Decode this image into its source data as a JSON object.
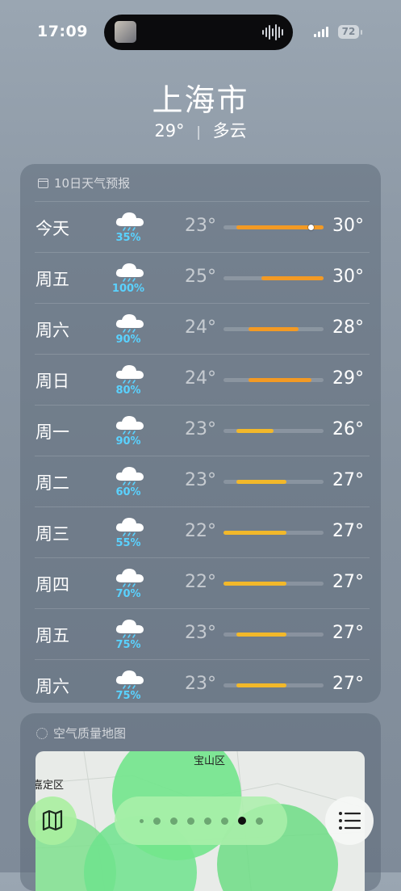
{
  "status_bar": {
    "time": "17:09",
    "battery": "72"
  },
  "location": {
    "city": "上海市",
    "temperature": "29°",
    "separator": "|",
    "condition": "多云"
  },
  "forecast": {
    "header": "10日天气预报",
    "scale_min": 22,
    "scale_max": 30,
    "current_temp": 29,
    "days": [
      {
        "day": "今天",
        "icon": "cloud-rain-icon",
        "precip": "35%",
        "low": "23°",
        "high": "30°",
        "lo": 23,
        "hi": 30
      },
      {
        "day": "周五",
        "icon": "cloud-rain-icon",
        "precip": "100%",
        "low": "25°",
        "high": "30°",
        "lo": 25,
        "hi": 30
      },
      {
        "day": "周六",
        "icon": "cloud-rain-icon",
        "precip": "90%",
        "low": "24°",
        "high": "28°",
        "lo": 24,
        "hi": 28
      },
      {
        "day": "周日",
        "icon": "cloud-rain-icon",
        "precip": "80%",
        "low": "24°",
        "high": "29°",
        "lo": 24,
        "hi": 29
      },
      {
        "day": "周一",
        "icon": "cloud-rain-icon",
        "precip": "90%",
        "low": "23°",
        "high": "26°",
        "lo": 23,
        "hi": 26
      },
      {
        "day": "周二",
        "icon": "cloud-rain-icon",
        "precip": "60%",
        "low": "23°",
        "high": "27°",
        "lo": 23,
        "hi": 27
      },
      {
        "day": "周三",
        "icon": "cloud-rain-icon",
        "precip": "55%",
        "low": "22°",
        "high": "27°",
        "lo": 22,
        "hi": 27
      },
      {
        "day": "周四",
        "icon": "cloud-rain-icon",
        "precip": "70%",
        "low": "22°",
        "high": "27°",
        "lo": 22,
        "hi": 27
      },
      {
        "day": "周五",
        "icon": "cloud-rain-icon",
        "precip": "75%",
        "low": "23°",
        "high": "27°",
        "lo": 23,
        "hi": 27
      },
      {
        "day": "周六",
        "icon": "cloud-rain-icon",
        "precip": "75%",
        "low": "23°",
        "high": "27°",
        "lo": 23,
        "hi": 27
      }
    ]
  },
  "air_quality": {
    "header": "空气质量地图",
    "labels": [
      "宝山区",
      "嘉定区"
    ]
  },
  "bottom_bar": {
    "pages": 8,
    "active_page": 6
  },
  "colors": {
    "precip": "#5ad2ff",
    "bar_warm": "#f39a24",
    "bar_mild": "#f2b82a",
    "map_green": "#6ee58a"
  }
}
